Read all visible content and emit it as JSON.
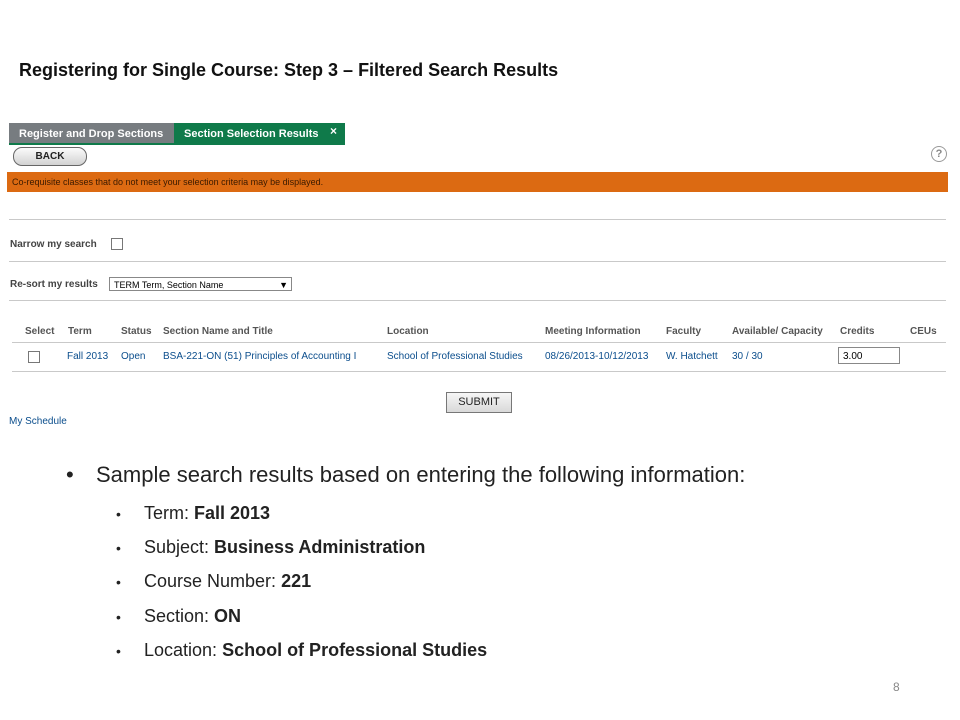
{
  "slide": {
    "title": "Registering for Single Course: Step 3 – Filtered Search Results",
    "page_number": "8"
  },
  "tabs": [
    {
      "label": "Register and Drop Sections",
      "active": false
    },
    {
      "label": "Section Selection Results",
      "active": true,
      "close_glyph": "×"
    }
  ],
  "toolbar": {
    "back_label": "BACK",
    "help_glyph": "?"
  },
  "banner": {
    "text": "Co-requisite classes that do not meet your selection criteria may be displayed.",
    "color": "#dc6a12"
  },
  "filters": {
    "narrow_label": "Narrow my search",
    "resort_label": "Re-sort my results",
    "resort_value": "TERM Term, Section Name"
  },
  "table": {
    "headers": [
      "Select",
      "Term",
      "Status",
      "Section Name and Title",
      "Location",
      "Meeting Information",
      "Faculty",
      "Available/ Capacity",
      "Credits",
      "CEUs"
    ],
    "rows": [
      {
        "term": "Fall 2013",
        "status": "Open",
        "section": "BSA-221-ON (51) Principles of Accounting I",
        "location": "School of Professional Studies",
        "meeting": "08/26/2013-10/12/2013",
        "faculty": "W. Hatchett",
        "availability": "30 / 30",
        "credits": "3.00",
        "ceus": ""
      }
    ]
  },
  "actions": {
    "submit_label": "SUBMIT",
    "my_schedule_label": "My Schedule"
  },
  "bullets": {
    "main": "Sample search results based on entering the following information:",
    "items": [
      {
        "label": "Term: ",
        "value": "Fall 2013"
      },
      {
        "label": "Subject: ",
        "value": "Business Administration"
      },
      {
        "label": "Course Number: ",
        "value": "221"
      },
      {
        "label": "Section: ",
        "value": "ON"
      },
      {
        "label": "Location: ",
        "value": "School of Professional Studies"
      }
    ]
  }
}
